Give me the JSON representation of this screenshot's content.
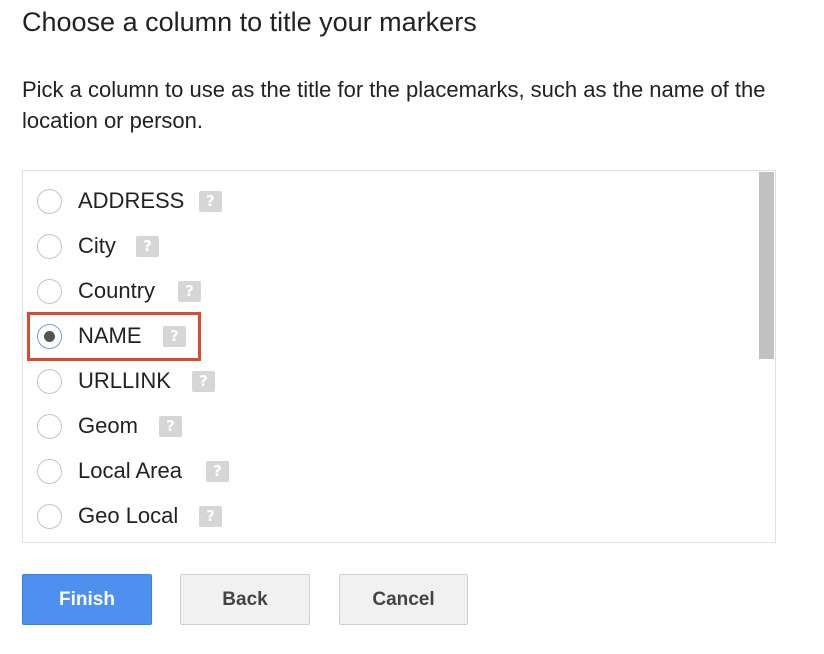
{
  "dialog": {
    "title": "Choose a column to title your markers",
    "description": "Pick a column to use as the title for the placemarks, such as the name of the location or person."
  },
  "options": [
    {
      "label": "ADDRESS",
      "checked": false,
      "help_glyph": "?"
    },
    {
      "label": "City",
      "checked": false,
      "help_glyph": "?"
    },
    {
      "label": "Country",
      "checked": false,
      "help_glyph": "?"
    },
    {
      "label": "NAME",
      "checked": true,
      "help_glyph": "?"
    },
    {
      "label": "URLLINK",
      "checked": false,
      "help_glyph": "?"
    },
    {
      "label": "Geom",
      "checked": false,
      "help_glyph": "?"
    },
    {
      "label": "Local Area",
      "checked": false,
      "help_glyph": "?"
    },
    {
      "label": "Geo Local",
      "checked": false,
      "help_glyph": "?"
    }
  ],
  "buttons": {
    "finish_label": "Finish",
    "back_label": "Back",
    "cancel_label": "Cancel"
  },
  "colors": {
    "finish_button": "#4d90f0",
    "highlight": "#db4a2f",
    "help_icon": "#d6d6d6"
  },
  "icons": {
    "help": "question-mark-icon",
    "radio": "radio-button"
  }
}
